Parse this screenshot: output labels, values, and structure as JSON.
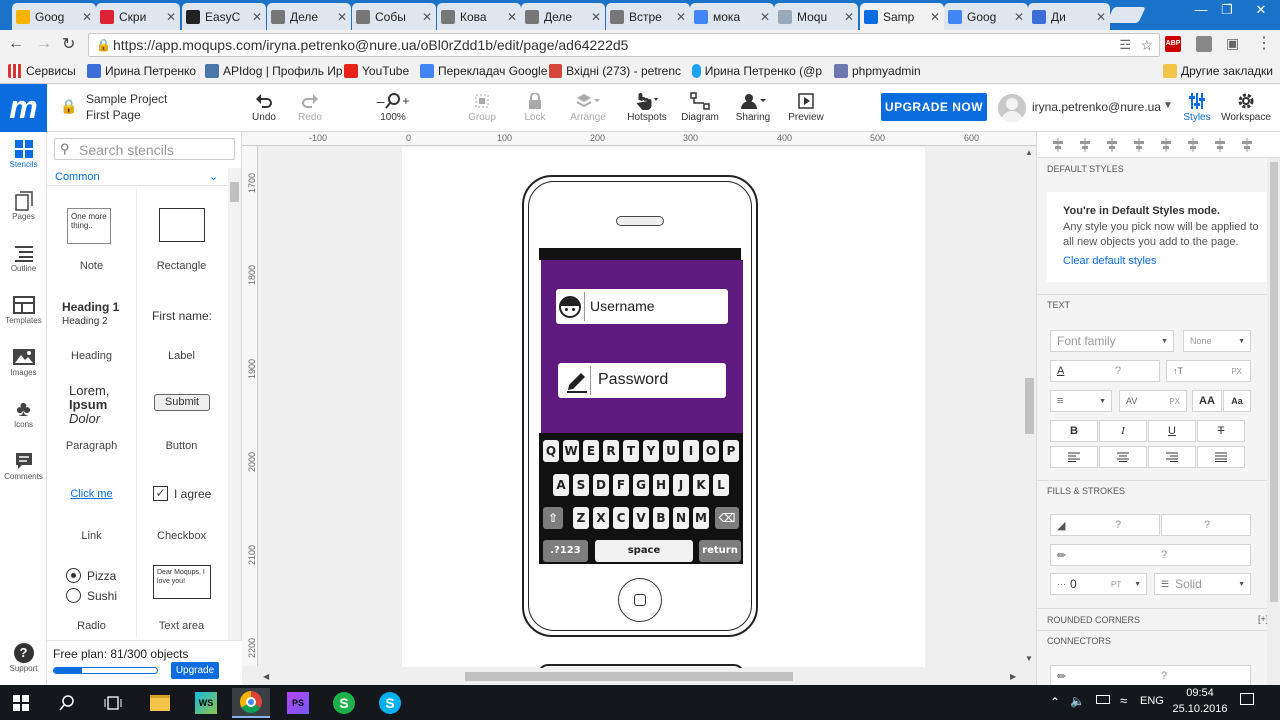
{
  "browser": {
    "tabs": [
      {
        "label": "Goog",
        "color": "#f4b400"
      },
      {
        "label": "Скри",
        "color": "#d23"
      },
      {
        "label": "EasyC",
        "color": "#222"
      },
      {
        "label": "Деле",
        "color": "#777"
      },
      {
        "label": "Собы",
        "color": "#777"
      },
      {
        "label": "Кова",
        "color": "#777"
      },
      {
        "label": "Деле",
        "color": "#777"
      },
      {
        "label": "Встре",
        "color": "#777"
      },
      {
        "label": "мока",
        "color": "#4285f4"
      },
      {
        "label": "Моqu",
        "color": "#9ab"
      },
      {
        "label": "Samp",
        "color": "#0b6ce0"
      },
      {
        "label": "Goog",
        "color": "#4285f4"
      },
      {
        "label": "Ди",
        "color": "#3b6ed8"
      }
    ],
    "url": "https://app.moqups.com/iryna.petrenko@nure.ua/oBl0rZdd1b/edit/page/ad64222d5",
    "bookmarks": [
      "Сервисы",
      "Ирина Петренко",
      "APIdog | Профиль Ир",
      "YouTube",
      "Перекладач Google",
      "Вхідні (273) - petrenc",
      "Ирина Петренко (@p",
      "phpmyadmin"
    ],
    "other_bookmarks": "Другие закладки"
  },
  "app": {
    "logo": "m",
    "project": "Sample Project",
    "page": "First Page",
    "toolbar": {
      "undo": "Undo",
      "redo": "Redo",
      "zoom": "100%",
      "group": "Group",
      "lock": "Lock",
      "arrange": "Arrange",
      "hotspots": "Hotspots",
      "diagram": "Diagram",
      "sharing": "Sharing",
      "preview": "Preview"
    },
    "upgrade_button": "UPGRADE NOW",
    "user_email": "iryna.petrenko@nure.ua",
    "styles_label": "Styles",
    "workspace_label": "Workspace"
  },
  "rail": [
    "Stencils",
    "Pages",
    "Outline",
    "Templates",
    "Images",
    "Icons",
    "Comments"
  ],
  "support": "Support",
  "stencils": {
    "search_placeholder": "Search stencils",
    "category": "Common",
    "items": [
      "Note",
      "Rectangle",
      "Heading",
      "Label",
      "Paragraph",
      "Button",
      "Link",
      "Checkbox",
      "Radio",
      "Text area"
    ],
    "note_text": "One more thing..",
    "heading1": "Heading 1",
    "heading2": "Heading 2",
    "label_text": "First name:",
    "para1": "Lorem,",
    "para2": "Ipsum",
    "para3": "Dolor",
    "button_text": "Submit",
    "link_text": "Click me",
    "checkbox_text": "I agree",
    "radio1": "Pizza",
    "radio2": "Sushi",
    "textarea_text": "Dear Moqups, I love you!",
    "plan_text": "Free plan: 81/300 objects",
    "plan_fraction": 0.27,
    "upgrade_small": "Upgrade"
  },
  "ruler": {
    "h": [
      "-100",
      "0",
      "100",
      "200",
      "300",
      "400",
      "500",
      "600"
    ],
    "v": [
      "1700",
      "1800",
      "1900",
      "2000",
      "2100",
      "2200"
    ]
  },
  "phone": {
    "username": "Username",
    "password": "Password",
    "row1": [
      "Q",
      "W",
      "E",
      "R",
      "T",
      "Y",
      "U",
      "I",
      "O",
      "P"
    ],
    "row2": [
      "A",
      "S",
      "D",
      "F",
      "G",
      "H",
      "J",
      "K",
      "L"
    ],
    "row3": [
      "Z",
      "X",
      "C",
      "V",
      "B",
      "N",
      "M"
    ],
    "k123": ".?123",
    "space": "space",
    "ret": "return",
    "screen_color": "#5e1a7e"
  },
  "styles_panel": {
    "default_styles": "DEFAULT STYLES",
    "mode_title": "You're in Default Styles mode.",
    "mode_desc": "Any style you pick now will be applied to all new objects you add to the page.",
    "clear_link": "Clear default styles",
    "text_hdr": "TEXT",
    "font_family": "Font family",
    "font_none": "None",
    "q": "?",
    "px": "PX",
    "aa_big": "AA",
    "aa_small": "Aa",
    "fills_hdr": "FILLS & STROKES",
    "stroke_width": "0",
    "pt": "PT",
    "solid": "Solid",
    "rounded": "ROUNDED CORNERS",
    "rounded_plus": "[+]",
    "connectors": "CONNECTORS"
  },
  "taskbar": {
    "lang": "ENG",
    "time": "09:54",
    "date": "25.10.2016"
  }
}
